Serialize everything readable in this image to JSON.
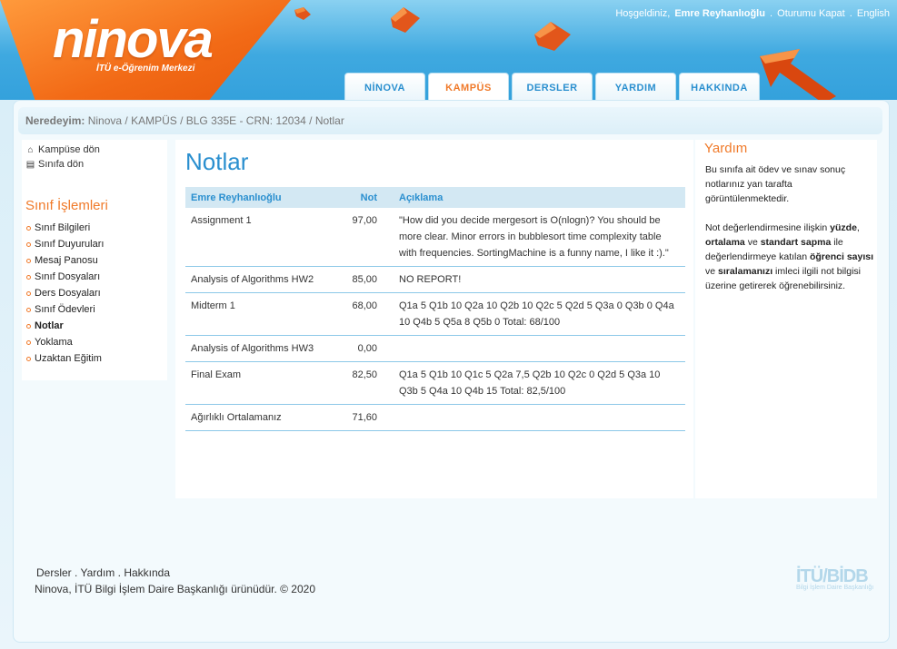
{
  "header": {
    "logo": "ninova",
    "logo_sub": "İTÜ e-Öğrenim Merkezi",
    "greeting": "Hoşgeldiniz,",
    "user": "Emre Reyhanlıoğlu",
    "sep": ".",
    "logout": "Oturumu Kapat",
    "english": "English",
    "tabs": [
      "NİNOVA",
      "KAMPÜS",
      "DERSLER",
      "YARDIM",
      "HAKKINDA"
    ],
    "active_tab": "KAMPÜS",
    "accent_color": "#f07a2a",
    "link_color": "#2a8fcf"
  },
  "breadcrumb": {
    "label": "Neredeyim:",
    "path": "Ninova / KAMPÜS / BLG 335E - CRN: 12034 / Notlar"
  },
  "left": {
    "links": [
      {
        "label": "Kampüse dön",
        "icon": "home-icon"
      },
      {
        "label": "Sınıfa dön",
        "icon": "page-icon"
      }
    ],
    "section_title": "Sınıf İşlemleri",
    "menu": [
      "Sınıf Bilgileri",
      "Sınıf Duyuruları",
      "Mesaj Panosu",
      "Sınıf Dosyaları",
      "Ders Dosyaları",
      "Sınıf Ödevleri",
      "Notlar",
      "Yoklama",
      "Uzaktan Eğitim"
    ],
    "active_menu": "Notlar"
  },
  "main": {
    "title": "Notlar",
    "columns": [
      "Emre Reyhanlıoğlu",
      "Not",
      "Açıklama"
    ],
    "rows": [
      {
        "name": "Assignment 1",
        "grade": "97,00",
        "note": "\"How did you decide mergesort is O(nlogn)? You should be more clear. Minor errors in bubblesort time complexity table with frequencies. SortingMachine is a funny name, I like it :).\""
      },
      {
        "name": "Analysis of Algorithms HW2",
        "grade": "85,00",
        "note": "NO REPORT!"
      },
      {
        "name": "Midterm 1",
        "grade": "68,00",
        "note": "Q1a 5 Q1b 10 Q2a 10 Q2b 10 Q2c 5 Q2d 5 Q3a 0 Q3b 0 Q4a 10 Q4b 5 Q5a 8 Q5b 0 Total: 68/100"
      },
      {
        "name": "Analysis of Algorithms HW3",
        "grade": "0,00",
        "note": ""
      },
      {
        "name": "Final Exam",
        "grade": "82,50",
        "note": "Q1a 5 Q1b 10 Q1c 5 Q2a 7,5 Q2b 10 Q2c 0 Q2d 5 Q3a 10 Q3b 5 Q4a 10 Q4b 15 Total: 82,5/100"
      },
      {
        "name": "Ağırlıklı Ortalamanız",
        "grade": "71,60",
        "note": ""
      }
    ]
  },
  "help": {
    "title": "Yardım",
    "p1": "Bu sınıfa ait ödev ve sınav sonuç notlarınız yan tarafta görüntülenmektedir.",
    "p2_a": "Not değerlendirmesine ilişkin ",
    "p2_b": "yüzde",
    "p2_c": ", ",
    "p2_d": "ortalama",
    "p2_e": " ve ",
    "p2_f": "standart sapma",
    "p2_g": " ile değerlendirmeye katılan ",
    "p2_h": "öğrenci sayısı",
    "p2_i": " ve ",
    "p2_j": "sıralamanızı",
    "p2_k": " imleci ilgili not bilgisi üzerine getirerek öğrenebilirsiniz."
  },
  "footer": {
    "links": [
      "Dersler",
      "Yardım",
      "Hakkında"
    ],
    "sep": ".",
    "copyright": "Ninova, İTÜ Bilgi İşlem Daire Başkanlığı ürünüdür. © 2020",
    "brand": "İTÜ/BİDB",
    "brand_sub": "Bilgi İşlem Daire Başkanlığı"
  }
}
